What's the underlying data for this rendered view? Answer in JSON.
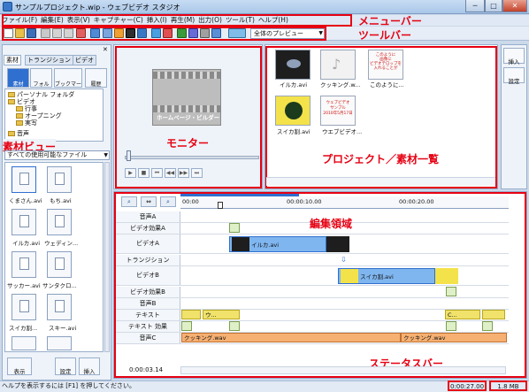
{
  "window": {
    "title": "サンプルプロジェクト.wip - ウェブビデオ スタジオ",
    "min_label": "─",
    "max_label": "□",
    "close_label": "✕"
  },
  "menu": [
    "ファイル(F)",
    "編集(E)",
    "表示(V)",
    "キャプチャー(C)",
    "挿入(I)",
    "再生(M)",
    "出力(O)",
    "ツール(T)",
    "ヘルプ(H)"
  ],
  "toolbar": {
    "preview_select": "全体のプレビュー"
  },
  "annotations": {
    "menubar": "メニューバー",
    "toolbar": "ツールバー",
    "monitor": "モニター",
    "project": "プロジェクト／素材一覧",
    "materials": "素材ビュー",
    "edit": "編集領域",
    "status": "ステータスバー"
  },
  "left": {
    "tabs": [
      "素材",
      "トランジション",
      "ビデオ"
    ],
    "modes": [
      "素材",
      "フォルダ",
      "ブックマーク",
      "履歴"
    ],
    "tree": [
      "パーソナル フォルダ",
      "ビデオ",
      "行事",
      "オープニング",
      "実写",
      "音声"
    ],
    "filter": "すべての使用可能なファイル",
    "thumbs": [
      "くまさん.avi",
      "もち.avi",
      "イルカ.avi",
      "ウェディン...",
      "サッカー.avi",
      "サンタクロ...",
      "スイカ割...",
      "スキー.avi"
    ],
    "bottom": [
      "表示",
      "設定",
      "挿入"
    ]
  },
  "monitor": {
    "caption": "ホームページ・ビルダー"
  },
  "project": {
    "items": [
      {
        "label": "イルカ.avi"
      },
      {
        "label": "クッキング.w..."
      },
      {
        "label": "このように...",
        "text": "このように\n画像に\nビデオテロップを\n入れることが"
      },
      {
        "label": "スイカ割.avi"
      },
      {
        "label": "ウエブビデオ...",
        "text": "ウェブビデオ\nサンプル\n2010年5月17日"
      }
    ],
    "right_buttons": [
      "挿入",
      "設定"
    ]
  },
  "timeline": {
    "ruler": [
      "00:00",
      "00:00:10.00",
      "00:00:20.00"
    ],
    "tracks": [
      "音声A",
      "ビデオ効果A",
      "ビデオA",
      "トランジション",
      "ビデオB",
      "ビデオ効果B",
      "音声B",
      "テキスト",
      "テキスト 効果",
      "音声C"
    ],
    "clips": {
      "videoA": "イルカ.avi",
      "videoB": "スイカ割.avi",
      "audioC1": "クッキング.wav",
      "audioC2": "クッキング.wav",
      "text1": "ウ...",
      "text2": "C..."
    },
    "timecode": "0:00:03.14"
  },
  "status": {
    "help": "ヘルプを表示するには [F1] を押してください。",
    "time": "0:00:27.00",
    "size": "1.8 MB"
  },
  "colors": {
    "accent": "#e60012",
    "track_blue": "#7fb6f0",
    "audio_orange": "#f6b072",
    "text_yellow": "#f0e26a"
  }
}
